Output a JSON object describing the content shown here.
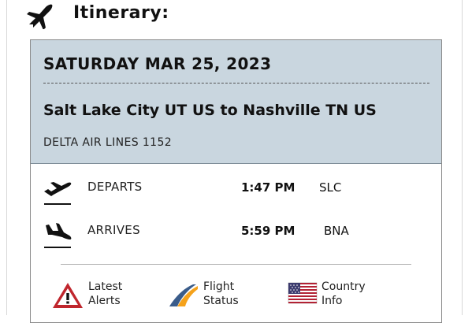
{
  "header": {
    "title": "Itinerary:"
  },
  "itinerary": {
    "date": "SATURDAY MAR 25, 2023",
    "route": "Salt Lake City UT US to Nashville TN US",
    "flight": "DELTA AIR LINES 1152",
    "departs": {
      "label": "DEPARTS",
      "time": "1:47 PM",
      "code": "SLC"
    },
    "arrives": {
      "label": "ARRIVES",
      "time": "5:59 PM",
      "code": "BNA"
    }
  },
  "links": {
    "alerts": {
      "line1": "Latest",
      "line2": "Alerts",
      "icon": "warning-icon"
    },
    "status": {
      "line1": "Flight",
      "line2": "Status",
      "icon": "flight-status-icon"
    },
    "country": {
      "line1": "Country",
      "line2": "Info",
      "icon": "us-flag-icon"
    }
  },
  "colors": {
    "header_bg": "#c9d6df",
    "warning_red": "#c0262d",
    "status_orange": "#f5a21b",
    "status_blue": "#3a5c8a"
  }
}
